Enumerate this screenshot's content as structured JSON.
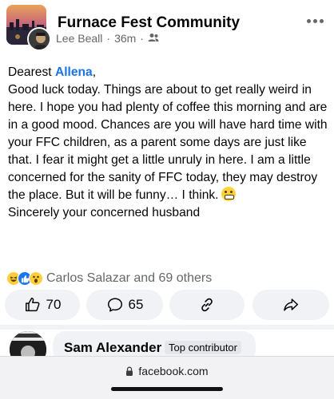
{
  "post": {
    "group_name": "Furnace Fest Community",
    "author": "Lee Beall",
    "time": "36m",
    "separator": "·",
    "privacy_icon": "members-icon",
    "more_icon": "more-horizontal-icon",
    "greeting_prefix": "Dearest ",
    "mention": "Allena",
    "greeting_suffix": ",",
    "body_text": "Good luck today. Things are about to get really weird in here. I hope you had plenty of coffee this morning and are in a good mood. Chances are you will have hard time with your FFC children, as a parent some days are just like that. I fear it might get a little unruly in here. I am a little concerned for the sanity of FFC today, they may destroy the place. But it will be funny… I think.",
    "body_emoji": "grimacing-face-emoji",
    "signoff": "Sincerely your concerned husband"
  },
  "reactions": {
    "icons": [
      "haha-reaction-icon",
      "like-reaction-icon",
      "wow-reaction-icon"
    ],
    "summary": "Carlos Salazar and 69 others"
  },
  "actions": {
    "like_count": "70",
    "comment_count": "65",
    "like_icon": "thumbs-up-icon",
    "comment_icon": "comment-icon",
    "share_link_icon": "link-icon",
    "share_icon": "share-arrow-icon"
  },
  "comment": {
    "name": "Sam Alexander",
    "badge": "Top contributor"
  },
  "browser": {
    "url": "facebook.com",
    "lock_icon": "lock-icon"
  },
  "colors": {
    "mention": "#1b74e4",
    "secondary_text": "#65676b",
    "button_bg": "#f0f2f5",
    "like_blue": "#1877f2"
  }
}
